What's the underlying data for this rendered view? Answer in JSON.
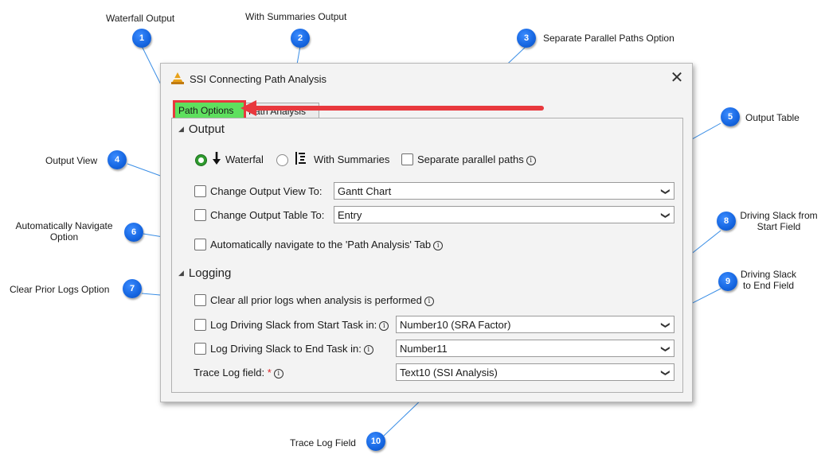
{
  "callouts": [
    {
      "num": "1",
      "label": "Waterfall Output"
    },
    {
      "num": "2",
      "label": "With Summaries Output"
    },
    {
      "num": "3",
      "label": "Separate Parallel Paths Option"
    },
    {
      "num": "4",
      "label": "Output View"
    },
    {
      "num": "5",
      "label": "Output Table"
    },
    {
      "num": "6",
      "label": "Automatically Navigate Option"
    },
    {
      "num": "7",
      "label": "Clear Prior Logs Option"
    },
    {
      "num": "8",
      "label": "Driving Slack from Start Field"
    },
    {
      "num": "9",
      "label": "Driving Slack to End Field"
    },
    {
      "num": "10",
      "label": "Trace Log Field"
    }
  ],
  "dialog": {
    "title": "SSI Connecting Path Analysis",
    "close_symbol": "✕",
    "tabs": [
      {
        "label": "Path Options",
        "active": true
      },
      {
        "label": "Path Analysis",
        "active": false
      }
    ],
    "output": {
      "heading": "Output",
      "waterfall_label": "Waterfal",
      "summaries_label": "With Summaries",
      "separate_label": "Separate parallel paths",
      "selected": "waterfall",
      "change_view_label": "Change Output View To:",
      "change_view_value": "Gantt Chart",
      "change_table_label": "Change Output Table To:",
      "change_table_value": "Entry",
      "auto_nav_label": "Automatically navigate to the 'Path Analysis' Tab"
    },
    "logging": {
      "heading": "Logging",
      "clear_logs_label": "Clear all prior logs when analysis is performed",
      "start_label": "Log Driving Slack from Start Task in:",
      "start_value": "Number10 (SRA Factor)",
      "end_label": "Log Driving Slack to End Task in:",
      "end_value": "Number11",
      "trace_label": "Trace Log field:",
      "trace_required": "*",
      "trace_value": "Text10 (SSI Analysis)"
    }
  },
  "colors": {
    "callout_blue": "#1565e0",
    "highlight_red": "#e8383d",
    "active_tab_green": "#5ee05e",
    "radio_green": "#2e9a2e",
    "leader_line": "#3a8ee6"
  }
}
